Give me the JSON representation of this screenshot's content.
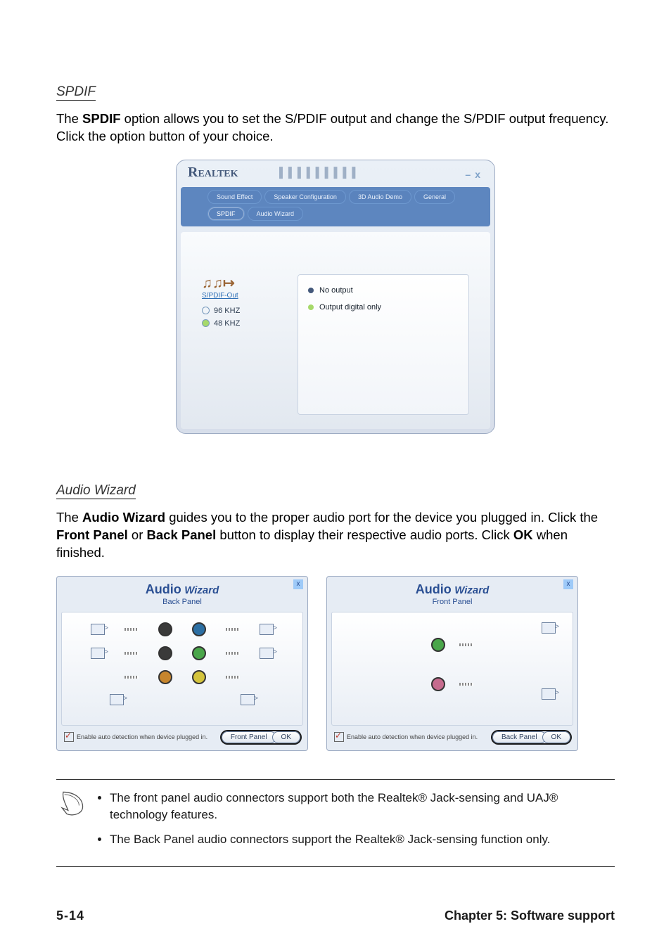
{
  "sections": {
    "spdif": {
      "title": "SPDIF",
      "paragraph_parts": [
        "The ",
        "SPDIF",
        " option allows you to set the S/PDIF output and change the S/PDIF output frequency. Click the option button of your choice."
      ]
    },
    "audio_wizard": {
      "title": "Audio Wizard",
      "paragraph_parts": [
        "The ",
        "Audio Wizard",
        " guides you to the proper audio port for the device you plugged in. Click the ",
        "Front Panel",
        " or ",
        "Back Panel",
        " button to display their respective audio ports. Click ",
        "OK",
        " when finished."
      ]
    }
  },
  "realtek_panel": {
    "brand": "Realtek",
    "window_controls": {
      "minimize": "–",
      "close": "x"
    },
    "tabs": [
      {
        "label": "Sound Effect",
        "active": false
      },
      {
        "label": "Speaker Configuration",
        "active": false
      },
      {
        "label": "3D Audio Demo",
        "active": false
      },
      {
        "label": "General",
        "active": false
      },
      {
        "label": "SPDIF",
        "active": true
      },
      {
        "label": "Audio Wizard",
        "active": false
      }
    ],
    "left": {
      "heading": "S/PDIF-Out",
      "freq": [
        "96 KHZ",
        "48 KHZ"
      ]
    },
    "right": {
      "opts": [
        "No output",
        "Output digital only"
      ]
    }
  },
  "wizards": {
    "title_big": "Audio",
    "title_small": "Wizard",
    "close": "x",
    "auto_detect": "Enable auto detection when device plugged in.",
    "ok_label": "OK",
    "back": {
      "subtitle": "Back Panel",
      "switch_button": "Front Panel"
    },
    "front": {
      "subtitle": "Front Panel",
      "switch_button": "Back Panel"
    }
  },
  "notes": [
    "The front panel audio connectors support both the Realtek® Jack-sensing and UAJ® technology features.",
    "The Back Panel audio connectors support the Realtek® Jack-sensing function only."
  ],
  "footer": {
    "page_number": "5-14",
    "chapter": "Chapter 5: Software support"
  }
}
